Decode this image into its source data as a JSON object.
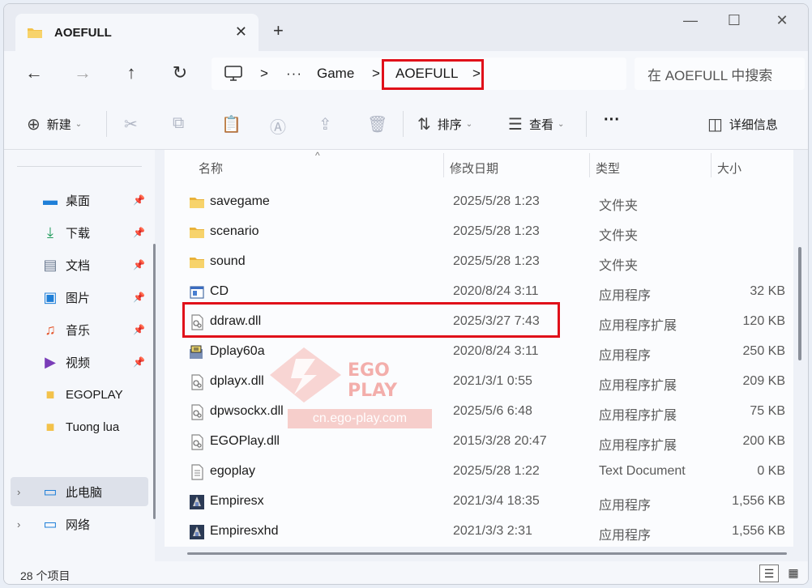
{
  "tab": {
    "title": "AOEFULL",
    "close": "✕",
    "new_tab": "+"
  },
  "window_controls": {
    "minimize": "—",
    "maximize": "☐",
    "close": "✕"
  },
  "nav": {
    "back": "←",
    "forward": "→",
    "up": "↑",
    "refresh": "↻"
  },
  "address": {
    "sep1": ">",
    "ellipsis": "···",
    "crumb1": "Game",
    "sep2": ">",
    "crumb2": "AOEFULL",
    "sep3": ">"
  },
  "search": {
    "placeholder": "在 AOEFULL 中搜索"
  },
  "toolbar": {
    "new_label": "新建",
    "sort_label": "排序",
    "view_label": "查看",
    "more": "···",
    "details_label": "详细信息"
  },
  "sidebar": {
    "items": [
      {
        "label": "桌面",
        "icon": "desktop-icon"
      },
      {
        "label": "下载",
        "icon": "download-icon"
      },
      {
        "label": "文档",
        "icon": "documents-icon"
      },
      {
        "label": "图片",
        "icon": "pictures-icon"
      },
      {
        "label": "音乐",
        "icon": "music-icon"
      },
      {
        "label": "视频",
        "icon": "videos-icon"
      },
      {
        "label": "EGOPLAY",
        "icon": "folder-icon"
      },
      {
        "label": "Tuong lua",
        "icon": "folder-icon"
      },
      {
        "label": "此电脑",
        "icon": "this-pc-icon"
      },
      {
        "label": "网络",
        "icon": "network-icon"
      }
    ]
  },
  "columns": {
    "name": "名称",
    "date": "修改日期",
    "type": "类型",
    "size": "大小"
  },
  "files": [
    {
      "name": "savegame",
      "date": "2025/5/28 1:23",
      "type": "文件夹",
      "size": "",
      "icon": "folder"
    },
    {
      "name": "scenario",
      "date": "2025/5/28 1:23",
      "type": "文件夹",
      "size": "",
      "icon": "folder"
    },
    {
      "name": "sound",
      "date": "2025/5/28 1:23",
      "type": "文件夹",
      "size": "",
      "icon": "folder"
    },
    {
      "name": "CD",
      "date": "2020/8/24 3:11",
      "type": "应用程序",
      "size": "32 KB",
      "icon": "app"
    },
    {
      "name": "ddraw.dll",
      "date": "2025/3/27 7:43",
      "type": "应用程序扩展",
      "size": "120 KB",
      "icon": "dll"
    },
    {
      "name": "Dplay60a",
      "date": "2020/8/24 3:11",
      "type": "应用程序",
      "size": "250 KB",
      "icon": "installer"
    },
    {
      "name": "dplayx.dll",
      "date": "2021/3/1 0:55",
      "type": "应用程序扩展",
      "size": "209 KB",
      "icon": "dll"
    },
    {
      "name": "dpwsockx.dll",
      "date": "2025/5/6 6:48",
      "type": "应用程序扩展",
      "size": "75 KB",
      "icon": "dll"
    },
    {
      "name": "EGOPlay.dll",
      "date": "2015/3/28 20:47",
      "type": "应用程序扩展",
      "size": "200 KB",
      "icon": "dll"
    },
    {
      "name": "egoplay",
      "date": "2025/5/28 1:22",
      "type": "Text Document",
      "size": "0 KB",
      "icon": "text"
    },
    {
      "name": "Empiresx",
      "date": "2021/3/4 18:35",
      "type": "应用程序",
      "size": "1,556 KB",
      "icon": "game"
    },
    {
      "name": "Empiresxhd",
      "date": "2021/3/3 2:31",
      "type": "应用程序",
      "size": "1,556 KB",
      "icon": "game"
    }
  ],
  "status": {
    "count": "28 个项目"
  },
  "watermark": {
    "brand": "EGO PLAY",
    "url": "cn.ego-play.com"
  },
  "colors": {
    "highlight": "#e0101a",
    "folder": "#f3c24a",
    "accent": "#0067c0"
  }
}
